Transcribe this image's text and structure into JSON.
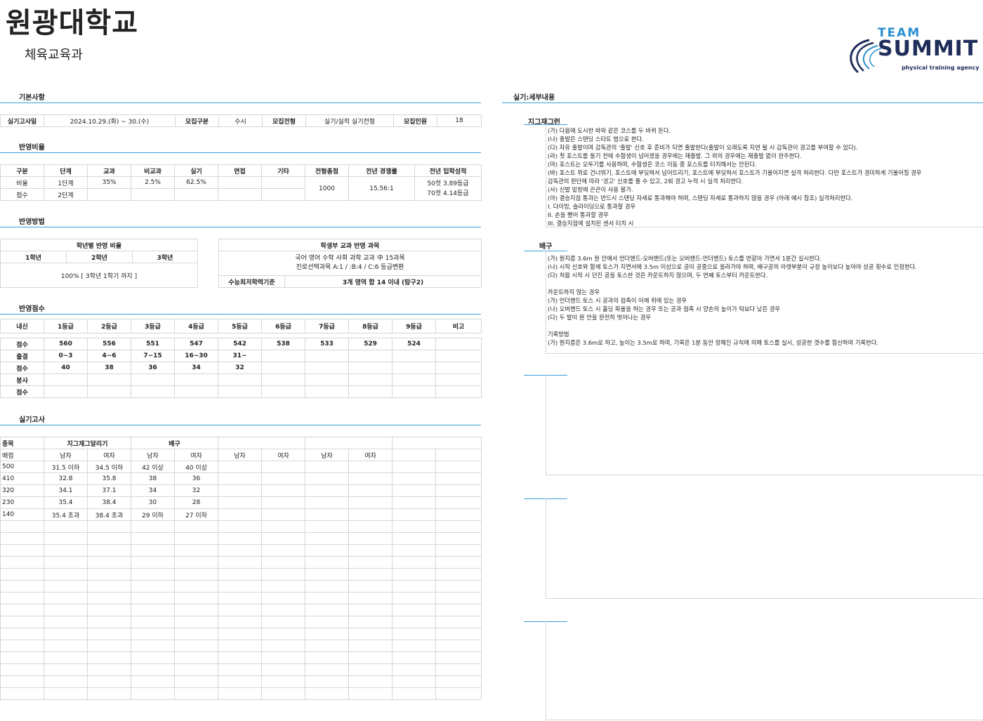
{
  "header": {
    "university": "원광대학교",
    "department": "체육교육과"
  },
  "logo": {
    "team": "TEAM",
    "summit": "SUMMIT",
    "tagline": "physical training agency",
    "color": "#2a8fd0"
  },
  "sections": {
    "basic": "기본사항",
    "ratio": "반영비율",
    "method": "반영방법",
    "score": "반영점수",
    "practical": "실기고사",
    "detail": "실기:세부내용"
  },
  "basic": {
    "date_label": "실기고사일",
    "date": "2024.10.29.(화) ~ 30.(수)",
    "type_label": "모집구분",
    "type": "수시",
    "track_label": "모집전형",
    "track": "실기/실적 실기전형",
    "count_label": "모집인원",
    "count": "18"
  },
  "ratio": {
    "headers": [
      "구분",
      "단계",
      "교과",
      "비교과",
      "실기",
      "면접",
      "기타",
      "전형총점",
      "전년 경쟁률",
      "전년 입학성적"
    ],
    "row1": [
      "비율",
      "1단계",
      "35%",
      "2.5%",
      "62.5%",
      "",
      ""
    ],
    "row2": [
      "점수",
      "2단계",
      "",
      "",
      "",
      "",
      ""
    ],
    "total": "1000",
    "competition": "15.56:1",
    "admission1": "50컷 3.89등급",
    "admission2": "70컷 4.14등급"
  },
  "method": {
    "grade_title": "학년별 반영 비율",
    "grades": [
      "1학년",
      "2학년",
      "3학년"
    ],
    "grade_value": "100% [ 3학년 1학기 까지 ]",
    "subject_title": "학생부 교과 반영 과목",
    "subject_line1": "국어 영어 수학 사회 과학 교과 中 15과목",
    "subject_line2": "진로선택과목 A:1 / :B:4 / C:6 등급변환",
    "min_label": "수능최저학력기준",
    "min_value": "3개 영역 합 14 이내 (탐구2)"
  },
  "score": {
    "headers": [
      "내신",
      "1등급",
      "2등급",
      "3등급",
      "4등급",
      "5등급",
      "6등급",
      "7등급",
      "8등급",
      "9등급",
      "비고"
    ],
    "rows": [
      [
        "점수",
        "560",
        "556",
        "551",
        "547",
        "542",
        "538",
        "533",
        "529",
        "524",
        ""
      ],
      [
        "출결",
        "0~3",
        "4~6",
        "7~15",
        "16~30",
        "31~",
        "",
        "",
        "",
        "",
        ""
      ],
      [
        "점수",
        "40",
        "38",
        "36",
        "34",
        "32",
        "",
        "",
        "",
        "",
        ""
      ],
      [
        "봉사",
        "",
        "",
        "",
        "",
        "",
        "",
        "",
        "",
        "",
        ""
      ],
      [
        "점수",
        "",
        "",
        "",
        "",
        "",
        "",
        "",
        "",
        "",
        ""
      ]
    ]
  },
  "practical": {
    "label_event": "종목",
    "event1": "지그재그달리기",
    "event2": "배구",
    "label_score": "배점",
    "sub": [
      "남자",
      "여자",
      "남자",
      "여자",
      "남자",
      "여자",
      "남자",
      "여자",
      "",
      ""
    ],
    "rows": [
      [
        "500",
        "31.5 이하",
        "34.5 이하",
        "42 이상",
        "40 이상"
      ],
      [
        "410",
        "32.8",
        "35.8",
        "38",
        "36"
      ],
      [
        "320",
        "34.1",
        "37.1",
        "34",
        "32"
      ],
      [
        "230",
        "35.4",
        "38.4",
        "30",
        "28"
      ],
      [
        "140",
        "35.4 초과",
        "38.4 초과",
        "29 이하",
        "27 이하"
      ]
    ]
  },
  "detail": {
    "zigzag_title": "지그재그런",
    "zigzag": [
      "(가) 다음에 도시한 바와 같은 코스를 두 바퀴 돈다.",
      "(나) 출발은 스탠딩 스타트 법으로 한다.",
      "(다) 자유 출발이며 감독관의 '출발' 신호 후 준비가 되면 출발한다(출발이 오래도록 지연 될 시 감독관이 경고를 부여할 수 있다).",
      "(라) 첫 포스트를 돌기 전에 수험생이 넘어졌을 경우에는 재출발. 그 외의 경우에는 재출발 없이 완주한다.",
      "(마) 포스트는 오뚜기를 사용하며, 수험생은 코스 이동 중 포스트를 터치해서는 안된다.",
      "(바) 포스트 위로 건너뛰기, 포스트에 부딪혀서 넘어뜨리기, 포스트에 부딪혀서 포스트가 기울어지면 실격 처리한다. 다만 포스트가 경미하게 기울어질 경우",
      "감독관의 판단에 따라 '경고' 신호를 줄 수 있고, 2회 경고 누적 시 실격 처리한다.",
      "(사) 신발 밑창에 끈끈이 사용 불가.",
      "(아) 결승지점 통과는 반드시 스탠딩 자세로 통과해야 하며, 스탠딩 자세로 통과하지 않을 경우 (아래 예시 참조) 실격처리한다.",
      "I. 다이빙, 슬라이딩으로 통과할 경우",
      "II. 손을 뻗어 통과할 경우",
      "III. 결승지점에 설치된 센서 터치 시"
    ],
    "volley_title": "배구",
    "volley": [
      "(가) 원지름 3.6m 원 안에서 언더핸드-오버핸드(또는 오버핸드-언더핸드) 토스를 번갈아 가면서 1분간 실시한다.",
      "(나) 시작 신호와 함께 토스가 지면서에 3.5m 이상으로 공이 공중으로 올라가야 하며, 배구공의 아랫부분이 규정 높이보다 높아야 성공 횟수로 인정한다.",
      "(다) 처음 시작 시 던진 공을 토스한 것은 카운트하지 않으며, 두 번째 토스부터 카운트한다.",
      "",
      "카운트하지 않는 경우",
      "(가) 언더핸드 토스 시 공과의 접촉이 어깨 위에 있는 경우",
      "(나) 오버핸드 토스 시 홀딩 파울을 하는 경우 또는 공과 접촉 시 양손의 높이가 턱보다 낮은 경우",
      "(다) 두 발이 원 안을 완전히 벗어나는 경우",
      "",
      "기록방법",
      "(가) 원지름은 3.6m로 하고, 높이는 3.5m로 하며, 기록은 1분 동안 정해진 규칙에 의해 토스를 실시, 성공한 갯수를 합산하여 기록한다."
    ]
  }
}
